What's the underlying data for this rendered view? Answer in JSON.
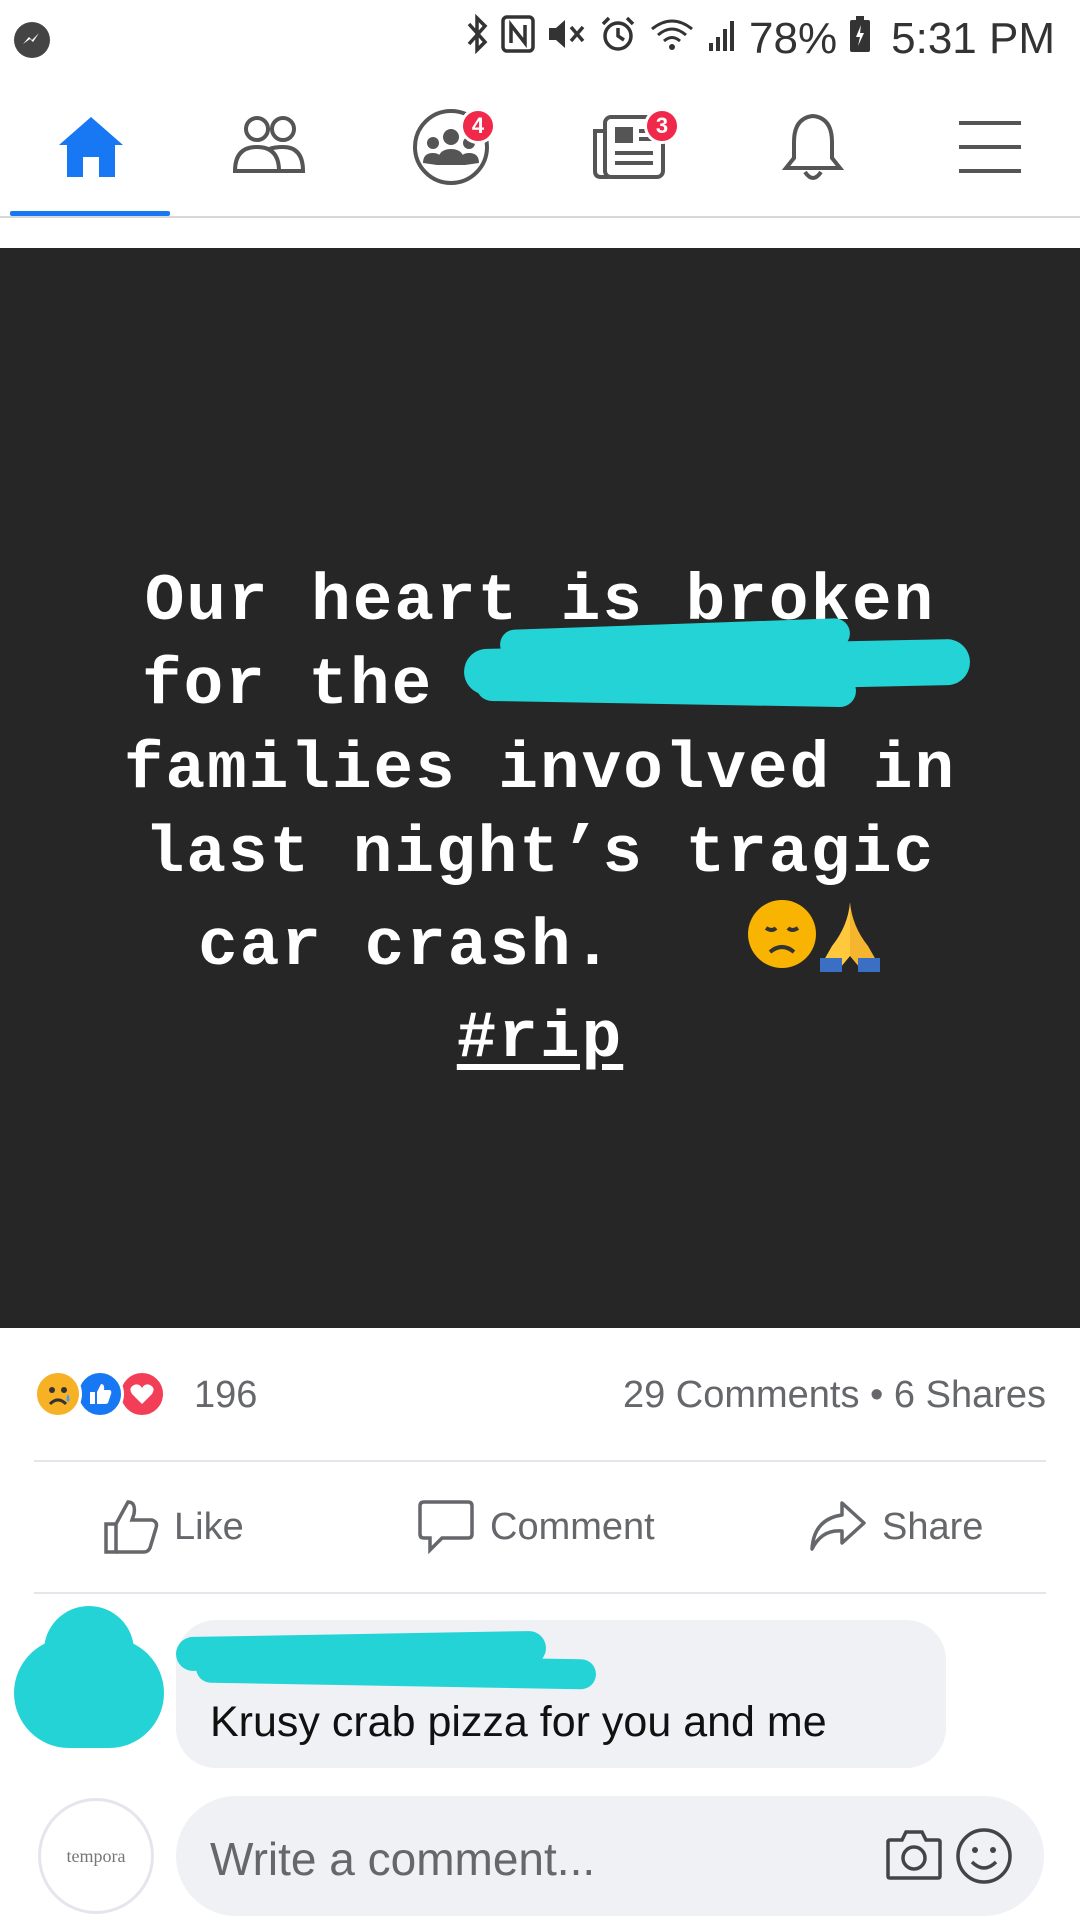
{
  "status_bar": {
    "battery": "78%",
    "time": "5:31 PM",
    "icons": [
      "messenger-icon",
      "bluetooth-icon",
      "nfc-icon",
      "mute-icon",
      "alarm-icon",
      "wifi-icon",
      "signal-icon",
      "battery-icon"
    ]
  },
  "nav": {
    "items": [
      {
        "name": "home",
        "icon": "home-icon",
        "active": true
      },
      {
        "name": "friends",
        "icon": "friends-icon"
      },
      {
        "name": "groups",
        "icon": "groups-icon",
        "badge": "4"
      },
      {
        "name": "news",
        "icon": "news-icon",
        "badge": "3"
      },
      {
        "name": "notifications",
        "icon": "bell-icon"
      },
      {
        "name": "menu",
        "icon": "hamburger-icon"
      }
    ],
    "accent": "#1877f2",
    "badge_color": "#f02849"
  },
  "post": {
    "lines": [
      "Our heart is broken",
      "for the",
      "families involved in",
      "last night’s tragic",
      "car crash."
    ],
    "hashtag": "#rip",
    "background": "#262626",
    "redaction_color": "#24d3d6"
  },
  "engagement": {
    "reaction_icons": [
      "sad-icon",
      "like-icon",
      "love-icon"
    ],
    "reaction_count": "196",
    "comments_shares": "29 Comments • 6 Shares"
  },
  "actions": {
    "like": "Like",
    "comment": "Comment",
    "share": "Share"
  },
  "comment": {
    "text": "Krusy crab pizza for you and me"
  },
  "composer": {
    "avatar_text": "tempora",
    "placeholder": "Write a comment..."
  }
}
